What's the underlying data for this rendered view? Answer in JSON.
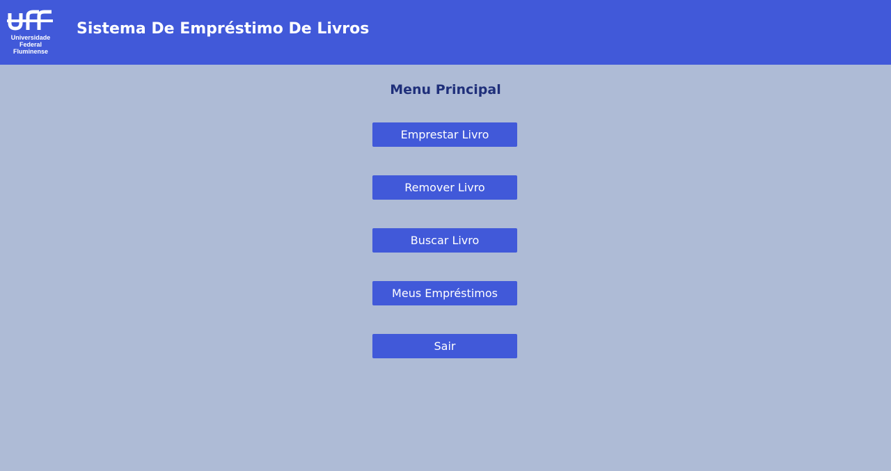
{
  "header": {
    "logo": {
      "mark": "uff",
      "lines": [
        "Universidade",
        "Federal",
        "Fluminense"
      ]
    },
    "title": "Sistema De Empréstimo De Livros"
  },
  "main": {
    "title": "Menu Principal",
    "buttons": [
      {
        "label": "Emprestar Livro"
      },
      {
        "label": "Remover Livro"
      },
      {
        "label": "Buscar Livro"
      },
      {
        "label": "Meus Empréstimos"
      },
      {
        "label": "Sair"
      }
    ]
  },
  "colors": {
    "header_bg": "#4159d9",
    "page_bg": "#aebbd6",
    "button_bg": "#4159d9",
    "title_text": "#1f2f7a"
  }
}
